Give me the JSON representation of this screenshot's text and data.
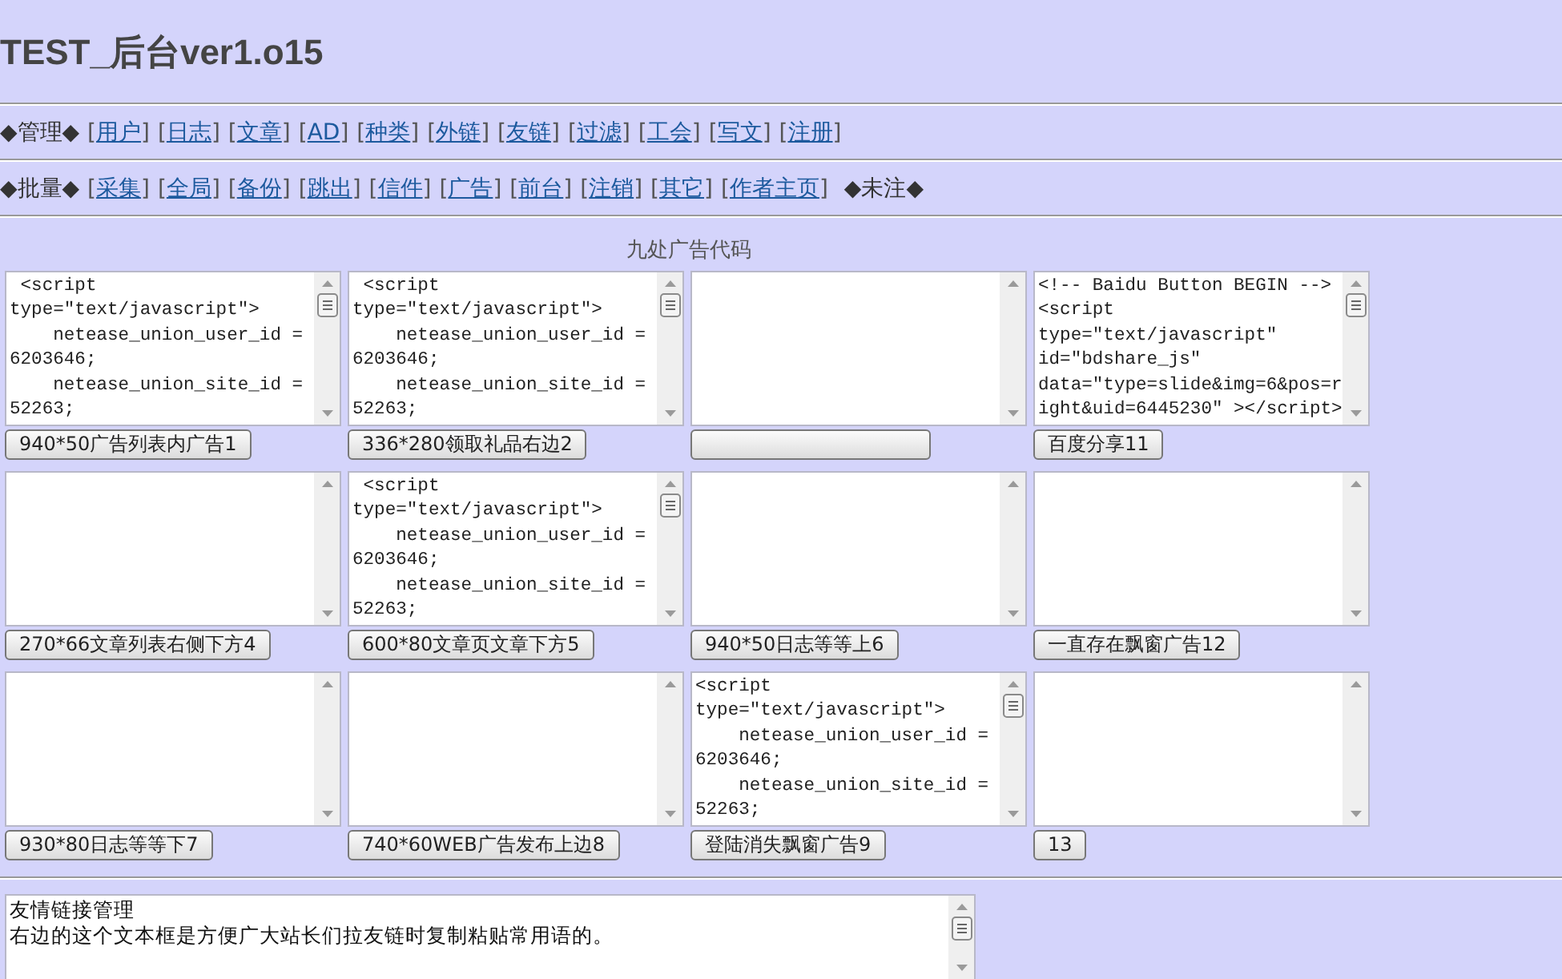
{
  "title": "TEST_后台ver1.o15",
  "nav_rows": [
    {
      "items": [
        {
          "kind": "label",
          "text": "◆管理◆"
        },
        {
          "kind": "link",
          "text": "用户"
        },
        {
          "kind": "link",
          "text": "日志"
        },
        {
          "kind": "link",
          "text": "文章"
        },
        {
          "kind": "link",
          "text": "AD"
        },
        {
          "kind": "link",
          "text": "种类"
        },
        {
          "kind": "link",
          "text": "外链"
        },
        {
          "kind": "link",
          "text": "友链"
        },
        {
          "kind": "link",
          "text": "过滤"
        },
        {
          "kind": "link",
          "text": "工会"
        },
        {
          "kind": "link",
          "text": "写文"
        },
        {
          "kind": "link",
          "text": "注册"
        }
      ]
    },
    {
      "items": [
        {
          "kind": "label",
          "text": "◆批量◆"
        },
        {
          "kind": "link",
          "text": "采集"
        },
        {
          "kind": "link",
          "text": "全局"
        },
        {
          "kind": "link",
          "text": "备份"
        },
        {
          "kind": "link",
          "text": "跳出"
        },
        {
          "kind": "link",
          "text": "信件"
        },
        {
          "kind": "link",
          "text": "广告"
        },
        {
          "kind": "link",
          "text": "前台"
        },
        {
          "kind": "link",
          "text": "注销"
        },
        {
          "kind": "link",
          "text": "其它"
        },
        {
          "kind": "link",
          "text": "作者主页"
        },
        {
          "kind": "label",
          "text": "◆未注◆"
        }
      ]
    }
  ],
  "bracket_open": "[",
  "bracket_close": "]",
  "section_title": "九处广告代码",
  "ad_slots": [
    {
      "lines": [
        " <script",
        "type=\"text/javascript\">",
        "    netease_union_user_id =",
        "6203646;",
        "    netease_union_site_id =",
        "52263;"
      ],
      "button": "940*50广告列表内广告1"
    },
    {
      "lines": [
        " <script",
        "type=\"text/javascript\">",
        "    netease_union_user_id =",
        "6203646;",
        "    netease_union_site_id =",
        "52263;"
      ],
      "button": "336*280领取礼品右边2"
    },
    {
      "kind": "unlabelled"
    },
    {
      "lines": [
        "<!-- Baidu Button BEGIN -->",
        "<script",
        "type=\"text/javascript\"",
        "id=\"bdshare_js\"",
        "data=\"type=slide&img=6&pos=r",
        "ight&uid=6445230\" ></script>"
      ],
      "button": "百度分享11"
    },
    {
      "button": "270*66文章列表右侧下方4"
    },
    {
      "lines": [
        " <script",
        "type=\"text/javascript\">",
        "    netease_union_user_id =",
        "6203646;",
        "    netease_union_site_id =",
        "52263;"
      ],
      "button": "600*80文章页文章下方5"
    },
    {
      "button": "940*50日志等等上6"
    },
    {
      "button": "一直存在飘窗广告12"
    },
    {
      "button": "930*80日志等等下7"
    },
    {
      "button": "740*60WEB广告发布上边8"
    },
    {
      "lines": [
        "<script",
        "type=\"text/javascript\">",
        "    netease_union_user_id =",
        "6203646;",
        "    netease_union_site_id =",
        "52263;"
      ],
      "button": "登陆消失飘窗广告9"
    },
    {
      "button": "13"
    }
  ],
  "links_box": {
    "lines": [
      "友情链接管理",
      "右边的这个文本框是方便广大站长们拉友链时复制粘贴常用语的。"
    ]
  }
}
